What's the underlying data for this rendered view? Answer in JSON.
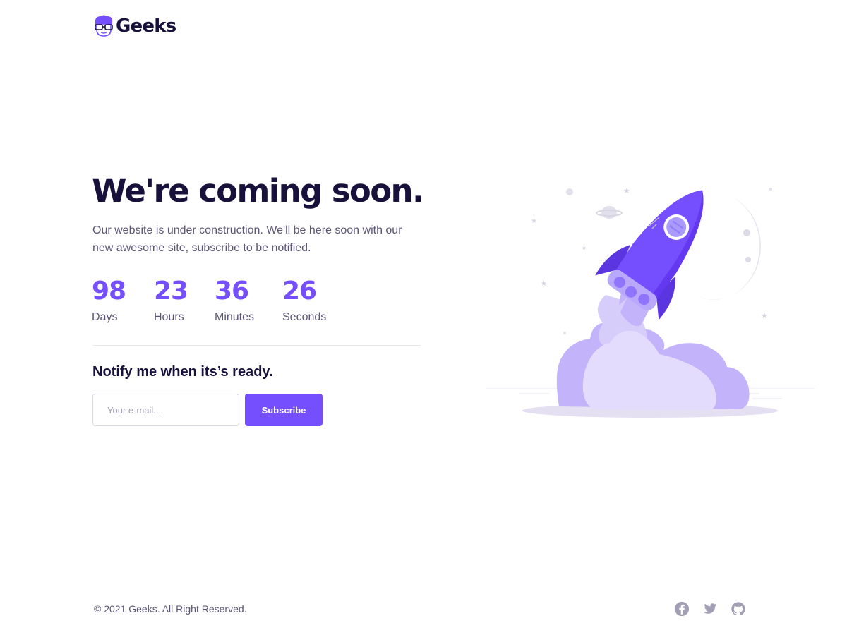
{
  "brand": {
    "name": "Geeks",
    "logo_icon": "geek-avatar-icon"
  },
  "hero": {
    "title": "We're coming soon.",
    "text": "Our website is under construction. We'll be here soon with our new awesome site, subscribe to be notified."
  },
  "countdown": [
    {
      "value": "98",
      "label": "Days"
    },
    {
      "value": "23",
      "label": "Hours"
    },
    {
      "value": "36",
      "label": "Minutes"
    },
    {
      "value": "26",
      "label": "Seconds"
    }
  ],
  "notify": {
    "title": "Notify me when its’s ready.",
    "email_placeholder": "Your e-mail...",
    "email_value": "",
    "subscribe_label": "Subscribe"
  },
  "footer": {
    "copyright": "© 2021 Geeks. All Right Reserved.",
    "social": [
      "facebook-icon",
      "twitter-icon",
      "github-icon"
    ]
  },
  "colors": {
    "primary": "#754ffe",
    "heading": "#18113c",
    "body_text": "#5d5575",
    "muted_icon": "#a29eb3"
  }
}
